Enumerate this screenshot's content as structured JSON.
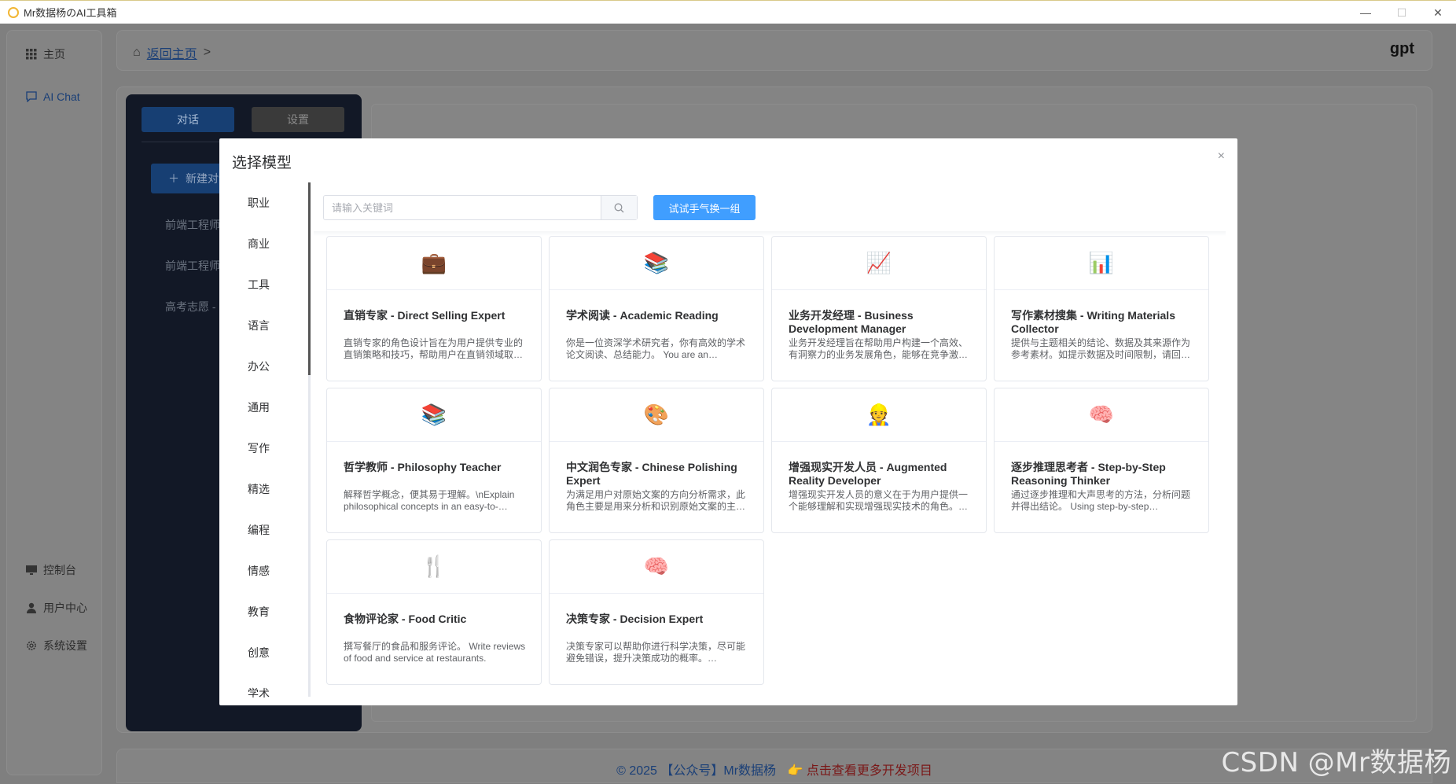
{
  "window": {
    "title": "Mr数据杨のAI工具箱",
    "controls": {
      "minimize": "—",
      "maximize": "☐",
      "close": "✕"
    }
  },
  "nav": {
    "items": [
      {
        "label": "主页",
        "icon": "grid-icon"
      },
      {
        "label": "AI Chat",
        "icon": "chat-icon"
      }
    ],
    "bottom_items": [
      {
        "label": "控制台",
        "icon": "monitor-icon"
      },
      {
        "label": "用户中心",
        "icon": "user-icon"
      },
      {
        "label": "系统设置",
        "icon": "gear-icon"
      }
    ]
  },
  "breadcrumb": {
    "home_link": "返回主页",
    "separator": ">"
  },
  "model_name": "gpt",
  "chat_sidebar": {
    "tab_chat": "对话",
    "tab_settings": "设置",
    "new_chat": "新建对话",
    "history": [
      "前端工程师",
      "前端工程师",
      "高考志愿 -"
    ]
  },
  "footer": {
    "copyright": "© 2025 【公众号】Mr数据杨",
    "promo": "👉 点击查看更多开发项目"
  },
  "watermark": "CSDN @Mr数据杨",
  "modal": {
    "title": "选择模型",
    "close": "×",
    "search_placeholder": "请输入关键词",
    "random_button": "试试手气换一组",
    "categories": [
      "职业",
      "商业",
      "工具",
      "语言",
      "办公",
      "通用",
      "写作",
      "精选",
      "编程",
      "情感",
      "教育",
      "创意",
      "学术"
    ],
    "cards": [
      {
        "emoji": "💼",
        "icon": "briefcase-icon",
        "title": "直销专家 - Direct Selling Expert",
        "desc": "直销专家的角色设计旨在为用户提供专业的直销策略和技巧，帮助用户在直销领域取…"
      },
      {
        "emoji": "📚",
        "icon": "books-icon",
        "title": "学术阅读 - Academic Reading",
        "desc": "你是一位资深学术研究者，你有高效的学术论文阅读、总结能力。 You are an…"
      },
      {
        "emoji": "📈",
        "icon": "chart-icon",
        "title": "业务开发经理 - Business Development Manager",
        "desc": "业务开发经理旨在帮助用户构建一个高效、有洞察力的业务发展角色，能够在竞争激…"
      },
      {
        "emoji": "📊",
        "icon": "bar-chart-icon",
        "title": "写作素材搜集 - Writing Materials Collector",
        "desc": "提供与主题相关的结论、数据及其来源作为参考素材。如提示数据及时间限制，请回…"
      },
      {
        "emoji": "📚",
        "icon": "books-icon",
        "title": "哲学教师 - Philosophy Teacher",
        "desc": "解释哲学概念，便其易于理解。\\nExplain philosophical concepts in an easy-to-…"
      },
      {
        "emoji": "🎨",
        "icon": "palette-icon",
        "title": "中文润色专家 - Chinese Polishing Expert",
        "desc": "为满足用户对原始文案的方向分析需求，此角色主要是用来分析和识别原始文案的主…"
      },
      {
        "emoji": "👷",
        "icon": "developer-icon",
        "title": "增强现实开发人员 - Augmented Reality Developer",
        "desc": "增强现实开发人员的意义在于为用户提供一个能够理解和实现增强现实技术的角色。…"
      },
      {
        "emoji": "🧠",
        "icon": "brain-icon",
        "title": "逐步推理思考者 - Step-by-Step Reasoning Thinker",
        "desc": "通过逐步推理和大声思考的方法，分析问题并得出结论。 Using step-by-step…"
      },
      {
        "emoji": "🍴",
        "icon": "fork-knife-icon",
        "title": "食物评论家 - Food Critic",
        "desc": "撰写餐厅的食品和服务评论。 Write reviews of food and service at restaurants."
      },
      {
        "emoji": "🧠",
        "icon": "brain-icon",
        "title": "决策专家 - Decision Expert",
        "desc": "决策专家可以帮助你进行科学决策，尽可能避免错误，提升决策成功的概率。…"
      }
    ]
  }
}
